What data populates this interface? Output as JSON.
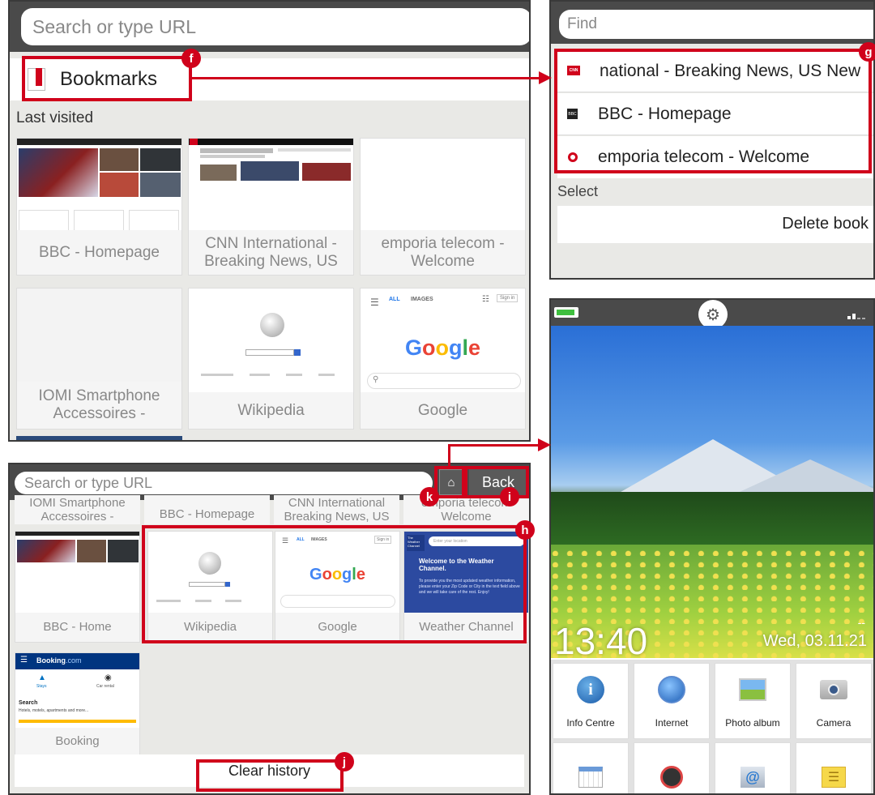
{
  "panel1": {
    "search_placeholder": "Search or type URL",
    "bookmarks_title": "Bookmarks",
    "last_visited": "Last visited",
    "thumbs": [
      {
        "line1": "BBC - Homepage",
        "line2": ""
      },
      {
        "line1": "CNN International -",
        "line2": "Breaking News, US"
      },
      {
        "line1": "emporia telecom -",
        "line2": "Welcome"
      },
      {
        "line1": "IOMI Smartphone",
        "line2": "Accessoires -"
      },
      {
        "line1": "Wikipedia",
        "line2": ""
      },
      {
        "line1": "Google",
        "line2": ""
      }
    ],
    "google_tabs": [
      "ALL",
      "IMAGES"
    ],
    "sign_in": "Sign in",
    "google_logo": "Google"
  },
  "panel2": {
    "find_placeholder": "Find",
    "bookmarks": [
      {
        "icon": "CNN",
        "label": "national - Breaking News, US New"
      },
      {
        "icon": "BBC",
        "label": "BBC - Homepage"
      },
      {
        "icon": "o",
        "label": "emporia telecom - Welcome"
      }
    ],
    "select_label": "Select",
    "delete_label": "Delete book"
  },
  "panel3": {
    "search_placeholder": "Search or type URL",
    "back_label": "Back",
    "home_icon": "home-icon",
    "top_captions": [
      {
        "line1": "IOMI Smartphone",
        "line2": "Accessoires -"
      },
      {
        "line1": "BBC - Homepage",
        "line2": ""
      },
      {
        "line1": "CNN International",
        "line2": "Breaking News, US"
      },
      {
        "line1": "emporia telecom",
        "line2": "Welcome"
      }
    ],
    "thumbs": [
      {
        "label": "BBC - Home"
      },
      {
        "label": "Wikipedia"
      },
      {
        "label": "Google"
      },
      {
        "label": "Weather Channel"
      }
    ],
    "weather": {
      "brand": "The Weather Channel",
      "search": "Enter your location",
      "headline": "Welcome to the Weather Channel.",
      "body": "To provide you the most updated weather information, please enter your Zip Code or City in the text field above and we will take care of the rest. Enjoy!"
    },
    "booking": {
      "brand": "Booking",
      "brand_suffix": ".com",
      "stays": "Stays",
      "car_rental": "Car rental",
      "search_title": "Search",
      "search_sub": "Hotels, motels, apartments and more...",
      "label": "Booking"
    },
    "clear_history": "Clear history"
  },
  "panel4": {
    "time": "13:40",
    "date": "Wed, 03.11.21",
    "dashes": "--",
    "tiles": [
      {
        "label": "Info Centre",
        "icon": "info-icon"
      },
      {
        "label": "Internet",
        "icon": "globe-icon"
      },
      {
        "label": "Photo album",
        "icon": "photo-icon"
      },
      {
        "label": "Camera",
        "icon": "camera-icon"
      },
      {
        "label": "",
        "icon": "calendar-icon"
      },
      {
        "label": "",
        "icon": "alarm-clock-icon"
      },
      {
        "label": "",
        "icon": "email-icon"
      },
      {
        "label": "",
        "icon": "notes-icon"
      }
    ]
  },
  "badges": {
    "f": "f",
    "g": "g",
    "h": "h",
    "i": "i",
    "j": "j",
    "k": "k"
  },
  "colors": {
    "accent": "#d0021b",
    "frame": "#4a4a4a",
    "panel_bg": "#e9e9e6"
  }
}
